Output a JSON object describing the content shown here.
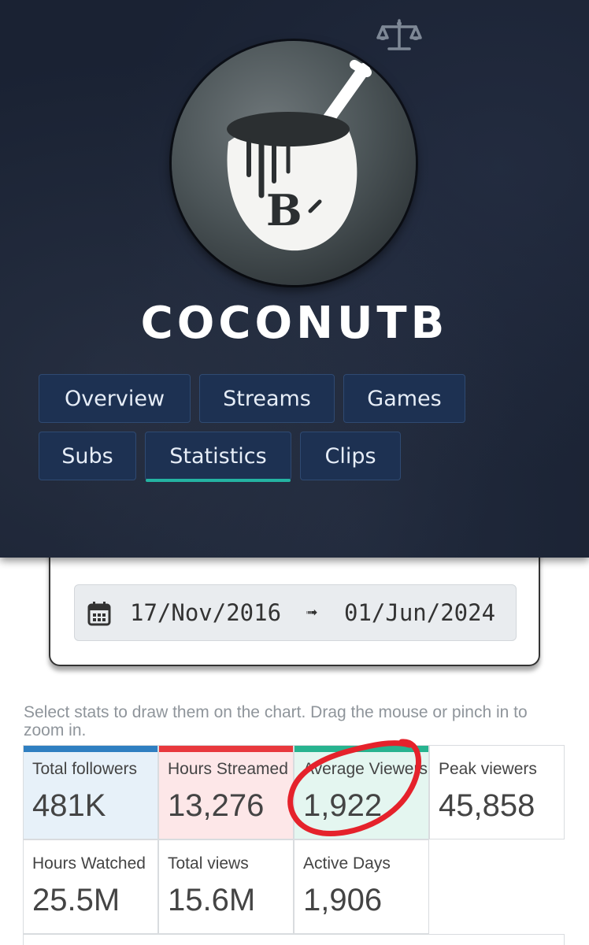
{
  "channel": {
    "name": "COCONUTB",
    "avatar_letter": "B"
  },
  "icons": {
    "compare": "scale-icon",
    "calendar": "calendar-icon"
  },
  "tabs": [
    {
      "label": "Overview",
      "active": false
    },
    {
      "label": "Streams",
      "active": false
    },
    {
      "label": "Games",
      "active": false
    },
    {
      "label": "Subs",
      "active": false
    },
    {
      "label": "Statistics",
      "active": true
    },
    {
      "label": "Clips",
      "active": false
    }
  ],
  "date_range": {
    "from": "17/Nov/2016",
    "arrow": "➟",
    "to": "01/Jun/2024"
  },
  "hint": "Select stats to draw them on the chart. Drag the mouse or pinch in to zoom in.",
  "stats": [
    {
      "label": "Total followers",
      "value": "481K",
      "selected": true,
      "accent": "#2f7fc1",
      "bg": "#e7f1f9"
    },
    {
      "label": "Hours Streamed",
      "value": "13,276",
      "selected": true,
      "accent": "#e8383d",
      "bg": "#fde7e8"
    },
    {
      "label": "Average Viewers",
      "value": "1,922",
      "selected": true,
      "accent": "#27b38f",
      "bg": "#e4f6f0"
    },
    {
      "label": "Peak viewers",
      "value": "45,858",
      "selected": false
    },
    {
      "label": "Hours Watched",
      "value": "25.5M",
      "selected": false
    },
    {
      "label": "Total views",
      "value": "15.6M",
      "selected": false
    },
    {
      "label": "Active Days",
      "value": "1,906",
      "selected": false
    }
  ],
  "colors": {
    "header_bg": "#1a2233",
    "tab_bg": "#1d3152",
    "tab_active_underline": "#24b3a2",
    "annotation_circle": "#e5222b"
  }
}
